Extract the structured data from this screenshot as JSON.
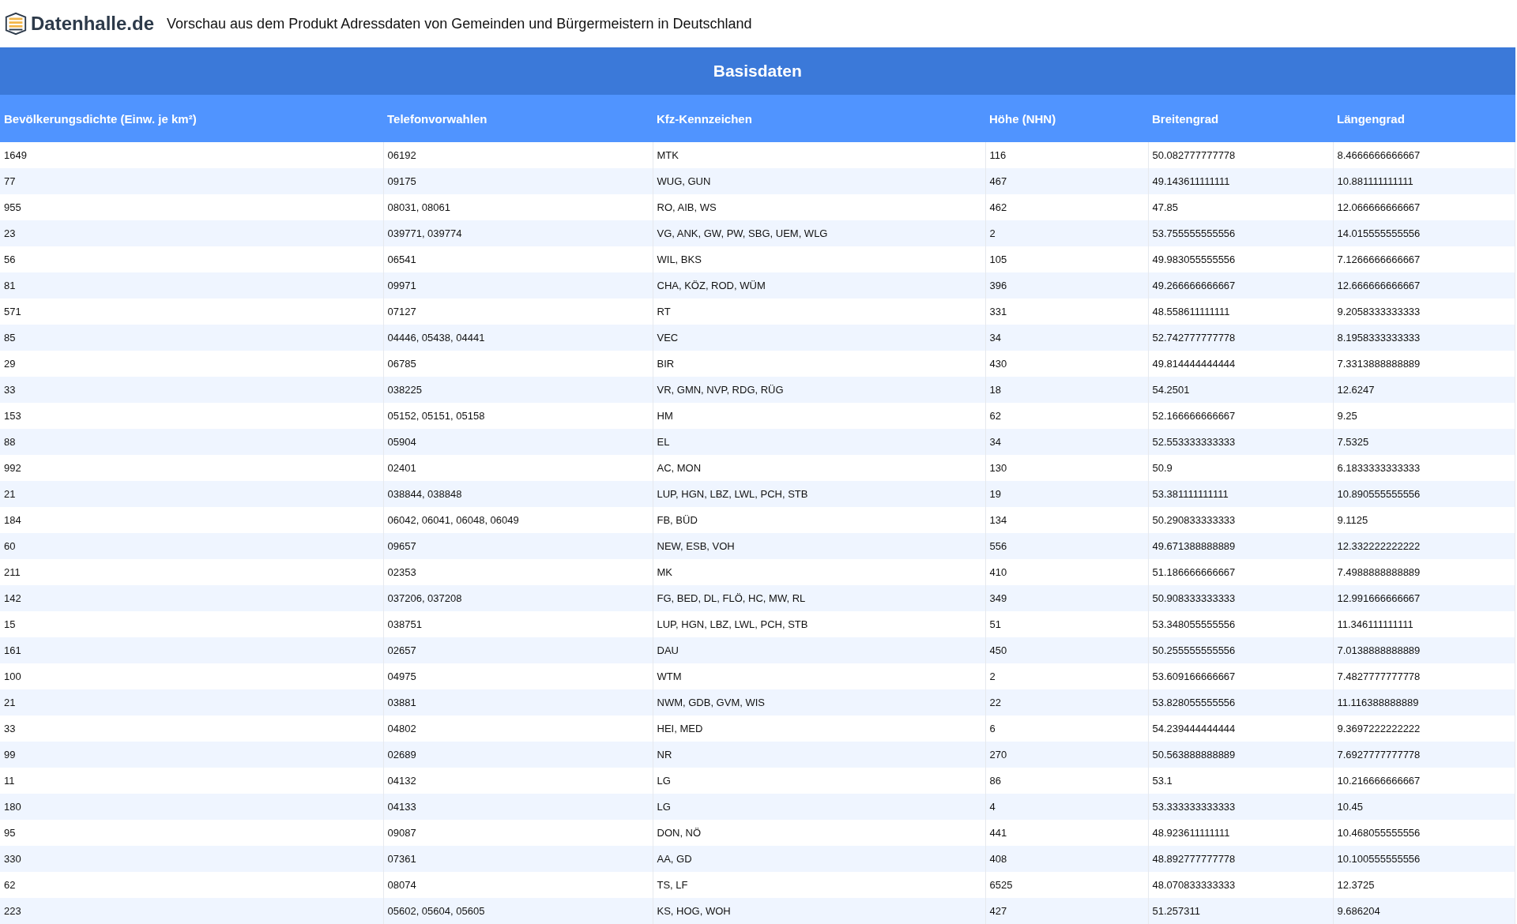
{
  "header": {
    "logo_text": "Datenhalle.de",
    "title": "Vorschau aus dem Produkt Adressdaten von Gemeinden und Bürgermeistern in Deutschland"
  },
  "table": {
    "group_title": "Basisdaten",
    "columns": [
      "Bevölkerungsdichte (Einw. je km²)",
      "Telefonvorwahlen",
      "Kfz-Kennzeichen",
      "Höhe (NHN)",
      "Breitengrad",
      "Längengrad"
    ],
    "rows": [
      [
        "1649",
        "06192",
        "MTK",
        "116",
        "50.082777777778",
        "8.4666666666667"
      ],
      [
        "77",
        "09175",
        "WUG, GUN",
        "467",
        "49.143611111111",
        "10.881111111111"
      ],
      [
        "955",
        "08031, 08061",
        "RO, AIB, WS",
        "462",
        "47.85",
        "12.066666666667"
      ],
      [
        "23",
        "039771, 039774",
        "VG, ANK, GW, PW, SBG, UEM, WLG",
        "2",
        "53.755555555556",
        "14.015555555556"
      ],
      [
        "56",
        "06541",
        "WIL, BKS",
        "105",
        "49.983055555556",
        "7.1266666666667"
      ],
      [
        "81",
        "09971",
        "CHA, KÖZ, ROD, WÜM",
        "396",
        "49.266666666667",
        "12.666666666667"
      ],
      [
        "571",
        "07127",
        "RT",
        "331",
        "48.558611111111",
        "9.2058333333333"
      ],
      [
        "85",
        "04446, 05438, 04441",
        "VEC",
        "34",
        "52.742777777778",
        "8.1958333333333"
      ],
      [
        "29",
        "06785",
        "BIR",
        "430",
        "49.814444444444",
        "7.3313888888889"
      ],
      [
        "33",
        "038225",
        "VR, GMN, NVP, RDG, RÜG",
        "18",
        "54.2501",
        "12.6247"
      ],
      [
        "153",
        "05152, 05151, 05158",
        "HM",
        "62",
        "52.166666666667",
        "9.25"
      ],
      [
        "88",
        "05904",
        "EL",
        "34",
        "52.553333333333",
        "7.5325"
      ],
      [
        "992",
        "02401",
        "AC, MON",
        "130",
        "50.9",
        "6.1833333333333"
      ],
      [
        "21",
        "038844, 038848",
        "LUP, HGN, LBZ, LWL, PCH, STB",
        "19",
        "53.381111111111",
        "10.890555555556"
      ],
      [
        "184",
        "06042, 06041, 06048, 06049",
        "FB, BÜD",
        "134",
        "50.290833333333",
        "9.1125"
      ],
      [
        "60",
        "09657",
        "NEW, ESB, VOH",
        "556",
        "49.671388888889",
        "12.332222222222"
      ],
      [
        "211",
        "02353",
        "MK",
        "410",
        "51.186666666667",
        "7.4988888888889"
      ],
      [
        "142",
        "037206, 037208",
        "FG, BED, DL, FLÖ, HC, MW, RL",
        "349",
        "50.908333333333",
        "12.991666666667"
      ],
      [
        "15",
        "038751",
        "LUP, HGN, LBZ, LWL, PCH, STB",
        "51",
        "53.348055555556",
        "11.346111111111"
      ],
      [
        "161",
        "02657",
        "DAU",
        "450",
        "50.255555555556",
        "7.0138888888889"
      ],
      [
        "100",
        "04975",
        "WTM",
        "2",
        "53.609166666667",
        "7.4827777777778"
      ],
      [
        "21",
        "03881",
        "NWM, GDB, GVM, WIS",
        "22",
        "53.828055555556",
        "11.116388888889"
      ],
      [
        "33",
        "04802",
        "HEI, MED",
        "6",
        "54.239444444444",
        "9.3697222222222"
      ],
      [
        "99",
        "02689",
        "NR",
        "270",
        "50.563888888889",
        "7.6927777777778"
      ],
      [
        "11",
        "04132",
        "LG",
        "86",
        "53.1",
        "10.216666666667"
      ],
      [
        "180",
        "04133",
        "LG",
        "4",
        "53.333333333333",
        "10.45"
      ],
      [
        "95",
        "09087",
        "DON, NÖ",
        "441",
        "48.923611111111",
        "10.468055555556"
      ],
      [
        "330",
        "07361",
        "AA, GD",
        "408",
        "48.892777777778",
        "10.100555555556"
      ],
      [
        "62",
        "08074",
        "TS, LF",
        "6525",
        "48.070833333333",
        "12.3725"
      ],
      [
        "223",
        "05602, 05604, 05605",
        "KS, HOG, WOH",
        "427",
        "51.257311",
        "9.686204"
      ]
    ]
  }
}
